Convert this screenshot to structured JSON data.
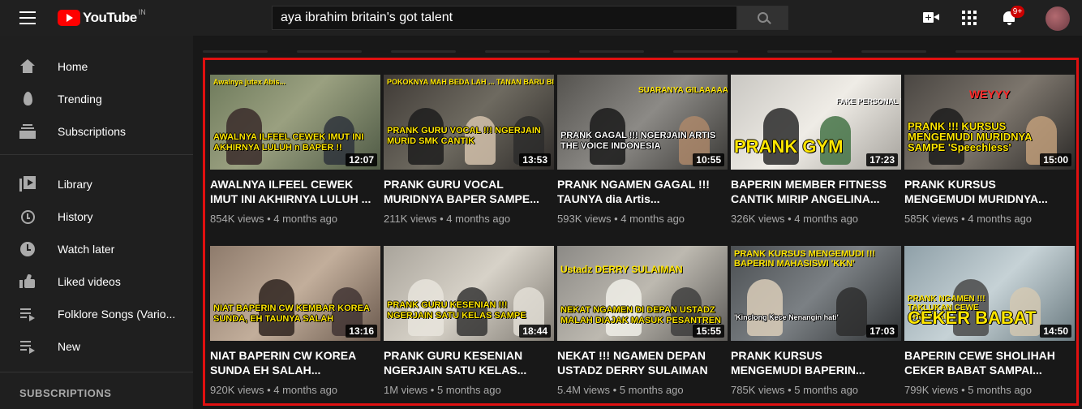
{
  "app": {
    "logo_text": "YouTube",
    "region": "IN"
  },
  "search": {
    "query": "aya ibrahim britain's got talent"
  },
  "header": {
    "notification_count": "9+"
  },
  "sidebar": {
    "items": [
      {
        "label": "Home",
        "icon": "home-icon"
      },
      {
        "label": "Trending",
        "icon": "trending-icon"
      },
      {
        "label": "Subscriptions",
        "icon": "subscriptions-icon"
      },
      {
        "label": "Library",
        "icon": "library-icon"
      },
      {
        "label": "History",
        "icon": "history-icon"
      },
      {
        "label": "Watch later",
        "icon": "watch-later-icon"
      },
      {
        "label": "Liked videos",
        "icon": "liked-videos-icon"
      },
      {
        "label": "Folklore Songs (Vario...",
        "icon": "playlist-icon"
      },
      {
        "label": "New",
        "icon": "playlist-icon"
      }
    ],
    "subscriptions_header": "SUBSCRIPTIONS"
  },
  "colors": {
    "accent": "#ff0000",
    "highlight_border": "#e01010",
    "bg": "#181818",
    "sidebar_bg": "#1f1f1f"
  },
  "videos": [
    {
      "title_l1": "AWALNYA ILFEEL CEWEK",
      "title_l2": "IMUT INI AKHIRNYA LULUH ...",
      "views": "854K views",
      "age": "4 months ago",
      "duration": "12:07",
      "thumb_top": "Awalnya jutex Abis...",
      "thumb_caption": "AWALNYA ILFEEL CEWEK IMUT INI AKHIRNYA LULUH n BAPER !!"
    },
    {
      "title_l1": "PRANK GURU VOCAL",
      "title_l2": "MURIDNYA BAPER SAMPE...",
      "views": "211K views",
      "age": "4 months ago",
      "duration": "13:53",
      "thumb_top": "POKOKNYA MAH BEDA LAH ... TANAN BARU BISA CAMAT",
      "thumb_caption": "PRANK GURU VOCAL !!! NGERJAIN MURID SMK CANTIK"
    },
    {
      "title_l1": "PRANK NGAMEN GAGAL !!!",
      "title_l2": "TAUNYA dia Artis...",
      "views": "593K views",
      "age": "4 months ago",
      "duration": "10:55",
      "thumb_top": "SUARANYA GILAAAAAA !!! BAPER ABISSSS",
      "thumb_caption": "PRANK GAGAL !!! NGERJAIN ARTIS THE VOICE INDONESIA"
    },
    {
      "title_l1": "BAPERIN MEMBER FITNESS",
      "title_l2": "CANTIK MIRIP ANGELINA...",
      "views": "326K views",
      "age": "4 months ago",
      "duration": "17:23",
      "thumb_top": "FAKE PERSONAL TRAINER",
      "thumb_caption": "PRANK GYM"
    },
    {
      "title_l1": "PRANK KURSUS",
      "title_l2": "MENGEMUDI MURIDNYA...",
      "views": "585K views",
      "age": "4 months ago",
      "duration": "15:00",
      "thumb_top": "WEYYY",
      "thumb_caption": "PRANK !!! KURSUS MENGEMUDI MURIDNYA SAMPE 'Speechless'"
    },
    {
      "title_l1": "NIAT BAPERIN CW KOREA",
      "title_l2": "SUNDA EH SALAH...",
      "views": "920K views",
      "age": "4 months ago",
      "duration": "13:16",
      "thumb_top": "",
      "thumb_caption": "NIAT BAPERIN CW KEMBAR KOREA SUNDA, EH TAUNYA SALAH NGEPRANK !!!"
    },
    {
      "title_l1": "PRANK GURU KESENIAN",
      "title_l2": "NGERJAIN SATU KELAS...",
      "views": "1M views",
      "age": "5 months ago",
      "duration": "18:44",
      "thumb_top": "",
      "thumb_caption": "PRANK GURU KESENIAN !!! NGERJAIN SATU KELAS SAMPE PECAH !"
    },
    {
      "title_l1": "NEKAT !!! NGAMEN DEPAN",
      "title_l2": "USTADZ DERRY SULAIMAN",
      "views": "5.4M views",
      "age": "5 months ago",
      "duration": "15:55",
      "thumb_top": "Ustadz DERRY SULAIMAN",
      "thumb_caption": "NEKAT NGAMEN DI DEPAN USTADZ MALAH DIAJAK MASUK PESANTREN !"
    },
    {
      "title_l1": "PRANK KURSUS",
      "title_l2": "MENGEMUDI BAPERIN...",
      "views": "785K views",
      "age": "5 months ago",
      "duration": "17:03",
      "thumb_top": "PRANK KURSUS MENGEMUDI !!! BAPERIN MAHASISWI 'KKN'",
      "thumb_caption": "'Kinclong Kece Nenangin hati'"
    },
    {
      "title_l1": "BAPERIN CEWE SHOLIHAH",
      "title_l2": "CEKER BABAT SAMPAI...",
      "views": "799K views",
      "age": "5 months ago",
      "duration": "14:50",
      "thumb_top": "PRANK NGAMEN !!! TAKLUKAN CEWE SHOLIHAH",
      "thumb_caption": "CEKER BABAT"
    }
  ]
}
